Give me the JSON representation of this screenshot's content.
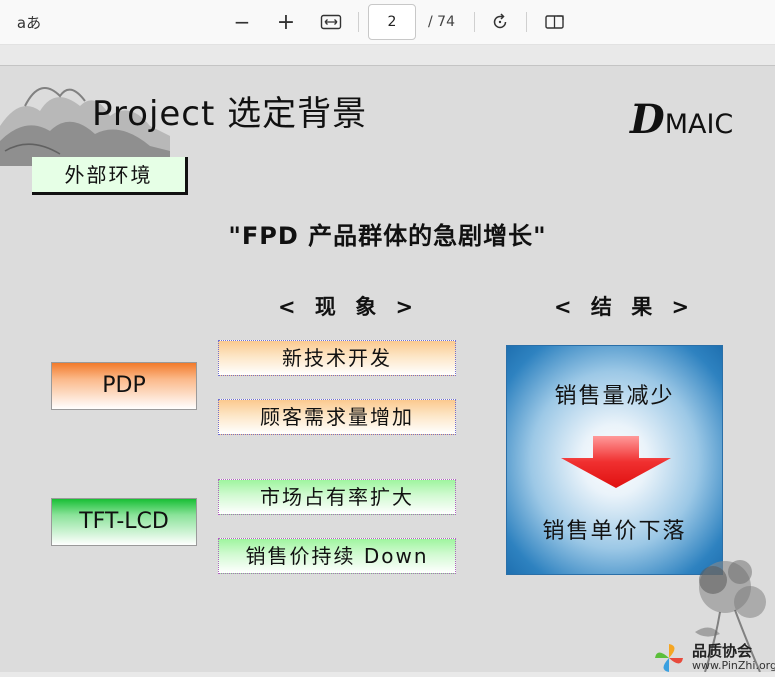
{
  "toolbar": {
    "read_aloud_label": "aあ",
    "zoom_out_symbol": "−",
    "zoom_in_symbol": "+",
    "page_current": "2",
    "page_total": "/ 74"
  },
  "slide": {
    "title": "Project 选定背景",
    "logo_initial": "D",
    "logo_rest": "MAIC",
    "env_label": "外部环境",
    "subtitle": "\"FPD 产品群体的急剧增长\"",
    "phenomena_header": "< 现 象 >",
    "result_header": "< 结 果 >",
    "categories": [
      {
        "label": "PDP",
        "color": "#f27a2a"
      },
      {
        "label": "TFT-LCD",
        "color": "#18bf35"
      }
    ],
    "phenomena": [
      "新技术开发",
      "顾客需求量增加",
      "市场占有率扩大",
      "销售价持续 Down"
    ],
    "results": {
      "top": "销售量减少",
      "bottom": "销售单价下落"
    }
  },
  "watermark": {
    "name": "品质协会",
    "url": "www.PinZhi.org"
  }
}
